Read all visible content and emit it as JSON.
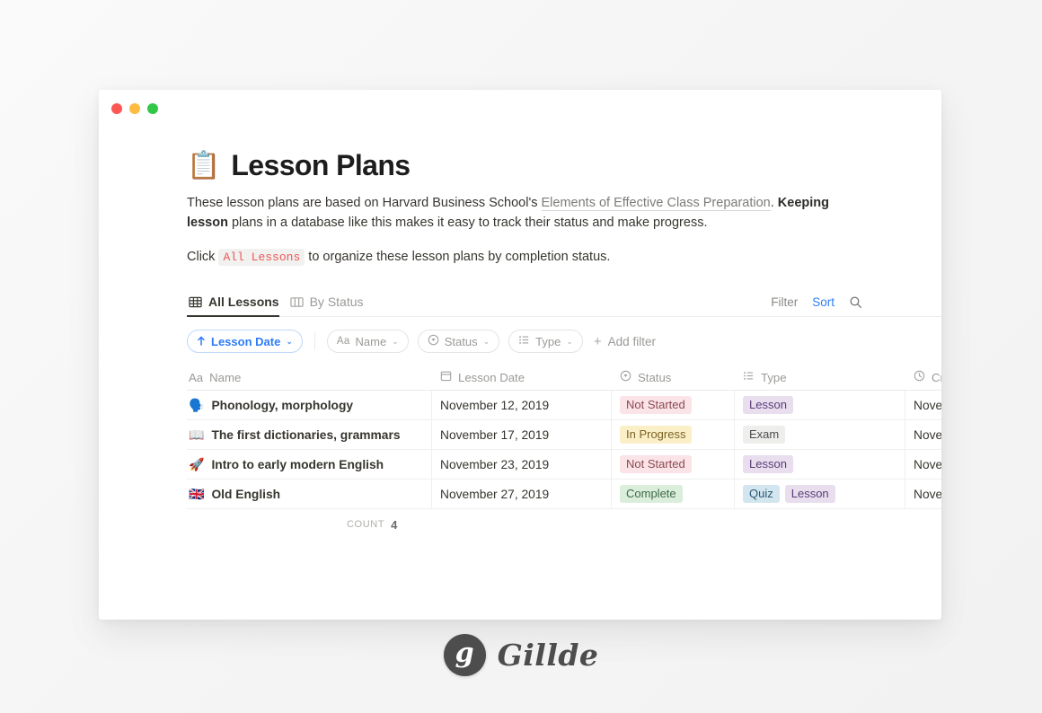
{
  "window": {
    "traffic_lights": [
      "close",
      "minimize",
      "maximize"
    ]
  },
  "page": {
    "emoji": "📋",
    "title": "Lesson Plans",
    "description_part1": "These lesson plans are based on Harvard Business School's ",
    "description_link": "Elements of Effective Class Preparation",
    "description_part2": ". ",
    "description_bold": "Keeping lesson",
    "description_part3": " plans in a database like this makes it easy to track their status and make progress.",
    "instruction_pre": "Click ",
    "instruction_code": "All Lessons",
    "instruction_post": " to organize these lesson plans by completion status."
  },
  "tabs": [
    {
      "label": "All Lessons",
      "icon": "table-icon",
      "active": true
    },
    {
      "label": "By Status",
      "icon": "board-icon",
      "active": false
    }
  ],
  "toolbar": {
    "filter_label": "Filter",
    "sort_label": "Sort",
    "search_icon": "search-icon"
  },
  "filters": {
    "sort_pill": {
      "label": "Lesson Date",
      "icon": "arrow-up-icon",
      "chevron": "⌄"
    },
    "pills": [
      {
        "label": "Name",
        "icon": "aa-icon",
        "icon_text": "Aa",
        "chevron": "⌄"
      },
      {
        "label": "Status",
        "icon": "select-circle-icon",
        "chevron": "⌄"
      },
      {
        "label": "Type",
        "icon": "multi-select-list-icon",
        "chevron": "⌄"
      }
    ],
    "add_filter_label": "Add filter",
    "add_filter_icon": "plus-icon"
  },
  "table": {
    "columns": [
      {
        "label": "Name",
        "icon": "aa-icon",
        "icon_text": "Aa"
      },
      {
        "label": "Lesson Date",
        "icon": "calendar-icon"
      },
      {
        "label": "Status",
        "icon": "select-circle-icon"
      },
      {
        "label": "Type",
        "icon": "multi-select-list-icon"
      },
      {
        "label": "Cr",
        "icon": "clock-icon"
      }
    ],
    "rows": [
      {
        "emoji": "🗣️",
        "name": "Phonology, morphology",
        "lesson_date": "November 12, 2019",
        "status": {
          "label": "Not Started",
          "color": "pink"
        },
        "types": [
          {
            "label": "Lesson",
            "color": "purple"
          }
        ],
        "created": "Nove"
      },
      {
        "emoji": "📖",
        "name": "The first dictionaries, grammars",
        "lesson_date": "November 17, 2019",
        "status": {
          "label": "In Progress",
          "color": "yellow"
        },
        "types": [
          {
            "label": "Exam",
            "color": "gray"
          }
        ],
        "created": "Nove"
      },
      {
        "emoji": "🚀",
        "name": "Intro to early modern English",
        "lesson_date": "November 23, 2019",
        "status": {
          "label": "Not Started",
          "color": "pink"
        },
        "types": [
          {
            "label": "Lesson",
            "color": "purple"
          }
        ],
        "created": "Nove"
      },
      {
        "emoji": "🇬🇧",
        "name": "Old English",
        "lesson_date": "November 27, 2019",
        "status": {
          "label": "Complete",
          "color": "green"
        },
        "types": [
          {
            "label": "Quiz",
            "color": "blue"
          },
          {
            "label": "Lesson",
            "color": "purple"
          }
        ],
        "created": "Nove"
      }
    ],
    "count_label": "COUNT",
    "count_value": "4"
  },
  "branding": {
    "mark_letter": "g",
    "name": "Gillde"
  },
  "colors": {
    "accent_blue": "#2e7cf6",
    "code_red": "#eb5757",
    "text_primary": "#37352f",
    "text_muted": "#9b9a97"
  }
}
